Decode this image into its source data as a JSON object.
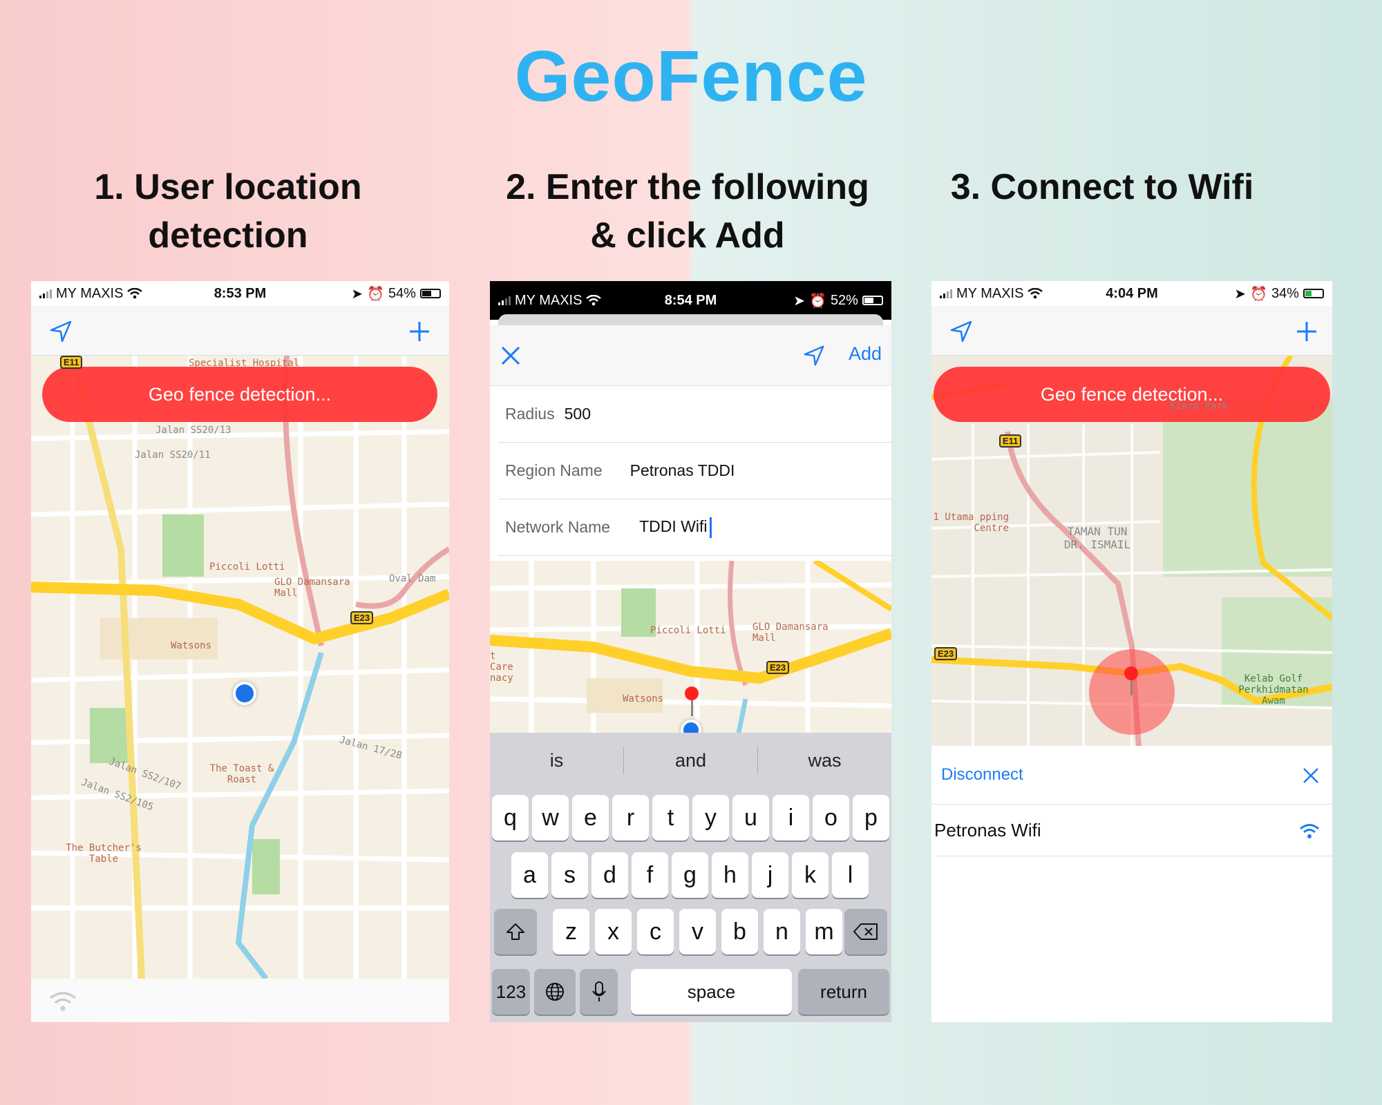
{
  "title": "GeoFence",
  "steps": [
    {
      "line1": "1. User location",
      "line2": "detection"
    },
    {
      "line1": "2. Enter the following",
      "line2": "& click Add"
    },
    {
      "line1": "3. Connect to Wifi",
      "line2": ""
    }
  ],
  "screen1": {
    "carrier": "MY MAXIS",
    "time": "8:53 PM",
    "battery": "54%",
    "banner": "Geo fence detection...",
    "map_labels": {
      "hospital": "Specialist Hospital",
      "ss20_13": "Jalan SS20/13",
      "ss20_11": "Jalan SS20/11",
      "piccoli": "Piccoli Lotti",
      "glo": "GLO Damansara Mall",
      "oval": "Oval Dam",
      "watsons": "Watsons",
      "toast": "The Toast & Roast",
      "butcher": "The Butcher's Table",
      "ss2_107": "Jalan SS2/107",
      "ss2_105": "Jalan SS2/105",
      "ss17_28": "Jalan 17/28",
      "e23": "E23",
      "e11": "E11"
    }
  },
  "screen2": {
    "carrier": "MY MAXIS",
    "time": "8:54 PM",
    "battery": "52%",
    "add_label": "Add",
    "radius_label": "Radius",
    "radius_value": "500",
    "region_label": "Region Name",
    "region_value": "Petronas TDDI",
    "network_label": "Network Name",
    "network_value": "TDDI Wifi",
    "map_labels": {
      "piccoli": "Piccoli Lotti",
      "glo": "GLO Damansara Mall",
      "watsons": "Watsons",
      "care": "t Care nacy",
      "e23": "E23"
    },
    "suggestions": [
      "is",
      "and",
      "was"
    ],
    "keyboard": {
      "row1": [
        "q",
        "w",
        "e",
        "r",
        "t",
        "y",
        "u",
        "i",
        "o",
        "p"
      ],
      "row2": [
        "a",
        "s",
        "d",
        "f",
        "g",
        "h",
        "j",
        "k",
        "l"
      ],
      "row3": [
        "z",
        "x",
        "c",
        "v",
        "b",
        "n",
        "m"
      ],
      "numbers": "123",
      "space": "space",
      "return": "return"
    }
  },
  "screen3": {
    "carrier": "MY MAXIS",
    "time": "4:04 PM",
    "battery": "34%",
    "banner": "Geo fence detection...",
    "map_labels": {
      "utama": "1 Utama pping Centre",
      "taman": "TAMAN TUN DR. ISMAIL",
      "kiara": "Kiara Park",
      "kelab": "Kelab Golf Perkhidmatan Awam",
      "e11": "E11",
      "e23": "E23"
    },
    "disconnect": "Disconnect",
    "wifi_name": "Petronas Wifi"
  },
  "colors": {
    "title": "#2fb2f2",
    "ios_blue": "#1a7cf5",
    "banner_red": "#ff3838",
    "pin_red": "#ff2020"
  },
  "icons": [
    "location-arrow-icon",
    "plus-icon",
    "close-icon",
    "wifi-icon",
    "backspace-icon",
    "shift-icon",
    "globe-icon",
    "microphone-icon",
    "alarm-icon"
  ]
}
